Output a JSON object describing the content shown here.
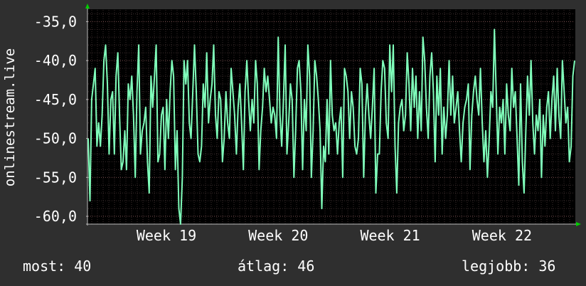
{
  "chart_data": {
    "type": "line",
    "ylabel": "onlinestream.live",
    "ylim": [
      -61,
      -33.5
    ],
    "yticks": [
      "-35,0",
      "-40,0",
      "-45,0",
      "-50,0",
      "-55,0",
      "-60,0"
    ],
    "ytick_values": [
      -35,
      -40,
      -45,
      -50,
      -55,
      -60
    ],
    "xticks": [
      "Week 19",
      "Week 20",
      "Week 21",
      "Week 22"
    ],
    "grid": true,
    "series": [
      {
        "color": "#80ffbb",
        "values": [
          -50,
          -58,
          -45,
          -43,
          -41,
          -51,
          -48,
          -51,
          -47,
          -40,
          -38,
          -43,
          -52,
          -45,
          -44,
          -52,
          -42,
          -39,
          -47,
          -54,
          -53,
          -49,
          -54,
          -43,
          -45,
          -42,
          -47,
          -55,
          -44,
          -38,
          -52,
          -49,
          -48,
          -46,
          -53,
          -57,
          -42,
          -46,
          -42,
          -38,
          -53,
          -52,
          -47,
          -46,
          -54,
          -45,
          -50,
          -44,
          -40,
          -42,
          -54,
          -49,
          -59,
          -61,
          -55,
          -40,
          -43,
          -40,
          -48,
          -50,
          -44,
          -38,
          -44,
          -52,
          -53,
          -51,
          -43,
          -46,
          -39,
          -48,
          -45,
          -43,
          -38,
          -47,
          -50,
          -44,
          -45,
          -53,
          -50,
          -44,
          -48,
          -50,
          -41,
          -44,
          -47,
          -52,
          -46,
          -43,
          -48,
          -54,
          -44,
          -40,
          -45,
          -49,
          -45,
          -48,
          -40,
          -43,
          -54,
          -49,
          -46,
          -41,
          -44,
          -42,
          -45,
          -48,
          -46,
          -47,
          -50,
          -37,
          -47,
          -51,
          -45,
          -38,
          -52,
          -48,
          -43,
          -45,
          -55,
          -49,
          -41,
          -40,
          -44,
          -54,
          -45,
          -49,
          -38,
          -42,
          -55,
          -49,
          -40,
          -42,
          -45,
          -49,
          -59,
          -51,
          -53,
          -45,
          -52,
          -40,
          -47,
          -49,
          -48,
          -52,
          -48,
          -46,
          -55,
          -41,
          -42,
          -44,
          -50,
          -44,
          -46,
          -51,
          -52,
          -50,
          -41,
          -43,
          -55,
          -47,
          -43,
          -47,
          -50,
          -46,
          -41,
          -57,
          -52,
          -52,
          -44,
          -40,
          -41,
          -48,
          -50,
          -38,
          -44,
          -38,
          -51,
          -57,
          -48,
          -46,
          -45,
          -49,
          -47,
          -39,
          -43,
          -49,
          -41,
          -46,
          -42,
          -50,
          -44,
          -49,
          -37,
          -40,
          -46,
          -50,
          -42,
          -39,
          -44,
          -53,
          -42,
          -47,
          -41,
          -52,
          -46,
          -50,
          -47,
          -40,
          -47,
          -42,
          -48,
          -46,
          -44,
          -49,
          -53,
          -48,
          -46,
          -45,
          -43,
          -54,
          -47,
          -44,
          -42,
          -45,
          -47,
          -41,
          -48,
          -53,
          -49,
          -55,
          -50,
          -44,
          -46,
          -36,
          -44,
          -52,
          -46,
          -48,
          -45,
          -52,
          -43,
          -47,
          -49,
          -41,
          -46,
          -44,
          -50,
          -56,
          -43,
          -53,
          -57,
          -49,
          -42,
          -47,
          -40,
          -48,
          -52,
          -47,
          -49,
          -45,
          -55,
          -47,
          -51,
          -46,
          -44,
          -50,
          -45,
          -42,
          -49,
          -41,
          -47,
          -50,
          -40,
          -44,
          -48,
          -46,
          -53,
          -51,
          -42,
          -40
        ]
      }
    ]
  },
  "stats": {
    "now": "most: 40",
    "avg": "átlag: 46",
    "best": "legjobb: 36"
  }
}
